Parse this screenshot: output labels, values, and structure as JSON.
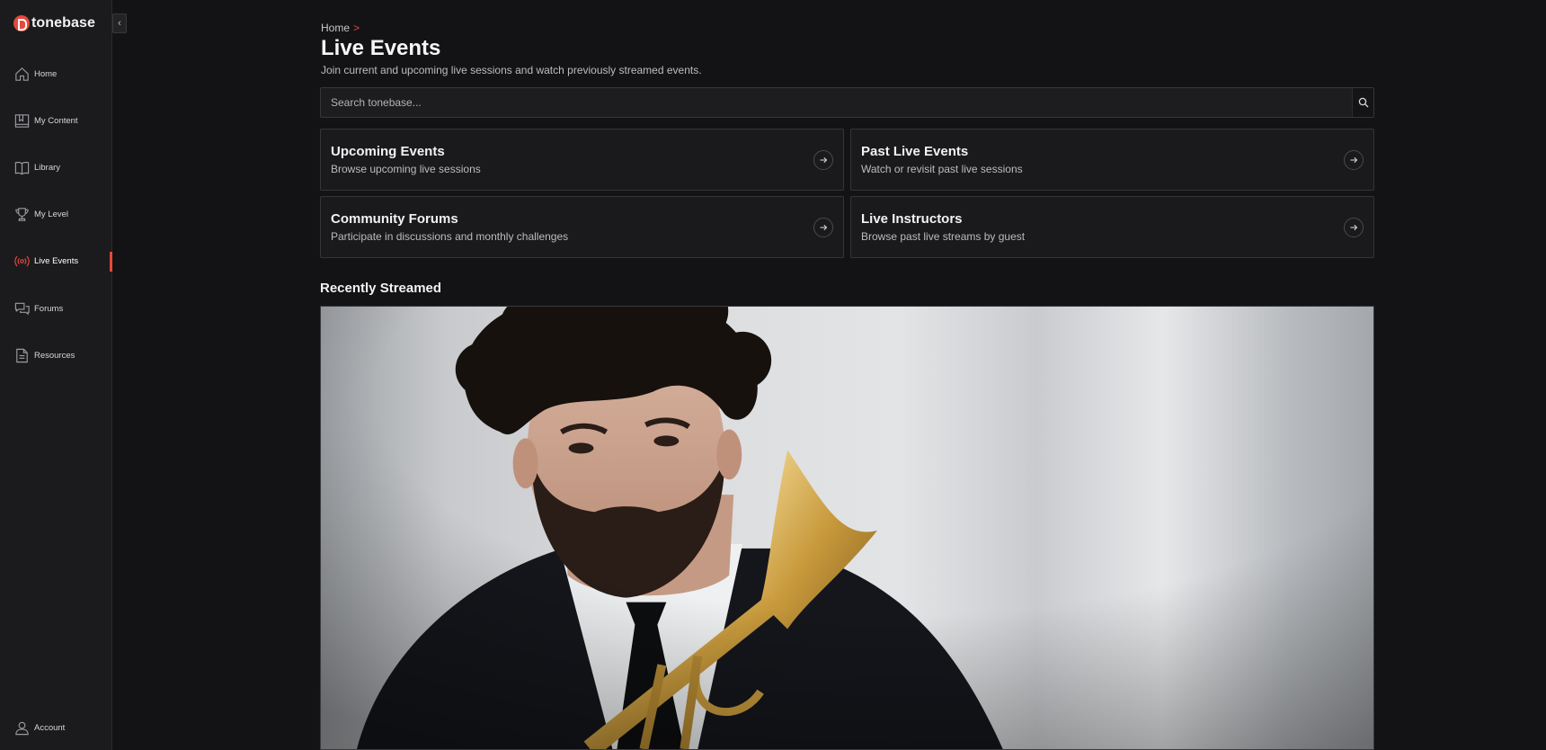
{
  "app": {
    "brand": "tonebase",
    "collapse_icon": "chevron-left-icon"
  },
  "sidebar": {
    "items": [
      {
        "label": "Home",
        "icon": "home-icon",
        "active": false
      },
      {
        "label": "My Content",
        "icon": "bookmark-book-icon",
        "active": false
      },
      {
        "label": "Library",
        "icon": "open-book-icon",
        "active": false
      },
      {
        "label": "My Level",
        "icon": "trophy-icon",
        "active": false
      },
      {
        "label": "Live Events",
        "icon": "broadcast-icon",
        "active": true
      },
      {
        "label": "Forums",
        "icon": "chat-bubbles-icon",
        "active": false
      },
      {
        "label": "Resources",
        "icon": "document-icon",
        "active": false
      }
    ],
    "account": {
      "label": "Account",
      "icon": "user-icon"
    }
  },
  "main": {
    "breadcrumb": {
      "home": "Home",
      "separator": ">"
    },
    "title": "Live Events",
    "subtitle": "Join current and upcoming live sessions and watch previously streamed events.",
    "search": {
      "placeholder": "Search tonebase...",
      "value": ""
    },
    "cards": [
      {
        "title": "Upcoming Events",
        "description": "Browse upcoming live sessions"
      },
      {
        "title": "Past Live Events",
        "description": "Watch or revisit past live sessions"
      },
      {
        "title": "Community Forums",
        "description": "Participate in discussions and monthly challenges"
      },
      {
        "title": "Live Instructors",
        "description": "Browse past live streams by guest"
      }
    ],
    "recently_streamed": {
      "title": "Recently Streamed"
    }
  },
  "colors": {
    "accent": "#e5493a",
    "background": "#131315",
    "sidebar": "#1b1b1d",
    "card": "#1a1a1c"
  }
}
